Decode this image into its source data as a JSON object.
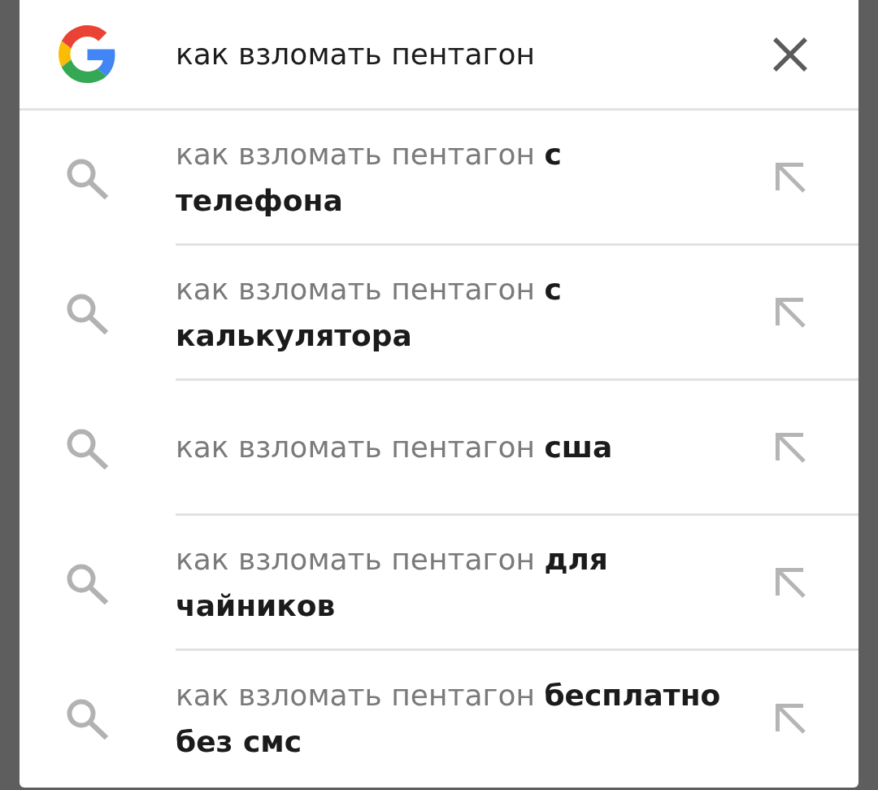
{
  "search_bar": {
    "query": "как взломать пентагон"
  },
  "suggestions": [
    {
      "text": "как взломать пентагон **с телефона**"
    },
    {
      "text": "как взломать пентагон **с калькулятора**"
    },
    {
      "text": "как взломать пентагон **сша**"
    },
    {
      "text": "как взломать пентагон **для чайников**"
    },
    {
      "text": "как взломать пентагон **бесплатно без смс**"
    }
  ]
}
